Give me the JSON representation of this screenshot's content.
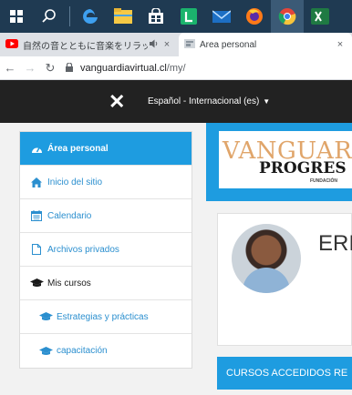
{
  "taskbar": {
    "icons": [
      "windows-icon",
      "search-icon",
      "edge-icon",
      "file-explorer-icon",
      "store-icon",
      "app-l-icon",
      "mail-icon",
      "firefox-icon",
      "chrome-icon",
      "excel-icon"
    ]
  },
  "browser": {
    "tabs": [
      {
        "label": "自然の音とともに音楽をリラック",
        "active": false,
        "audio_icon": "speaker-icon",
        "close": "×"
      },
      {
        "label": "Área personal",
        "active": true,
        "close": "×"
      }
    ],
    "url_host": "vanguardiavirtual.cl",
    "url_path": "/my/"
  },
  "navbar": {
    "close_glyph": "✕",
    "language": "Español - Internacional (es)"
  },
  "sidebar": {
    "items": [
      {
        "label": "Área personal",
        "icon": "dashboard-icon"
      },
      {
        "label": "Inicio del sitio",
        "icon": "home-icon"
      },
      {
        "label": "Calendario",
        "icon": "calendar-icon"
      },
      {
        "label": "Archivos privados",
        "icon": "file-icon"
      },
      {
        "label": "Mis cursos",
        "icon": "graduation-cap-icon"
      },
      {
        "label": "Estrategias y prácticas",
        "icon": "graduation-cap-icon"
      },
      {
        "label": "capacitación",
        "icon": "graduation-cap-icon"
      }
    ]
  },
  "logo": {
    "line1": "VANGUARD",
    "line2": "PROGRES",
    "line3": "FUNDACIÓN"
  },
  "profile": {
    "name": "ERI"
  },
  "courses": {
    "heading": "CURSOS ACCEDIDOS RE"
  },
  "colors": {
    "accent": "#1e9ce0",
    "navbar": "#222222",
    "taskbar": "#1f3a52",
    "link": "#2b8fcf"
  }
}
